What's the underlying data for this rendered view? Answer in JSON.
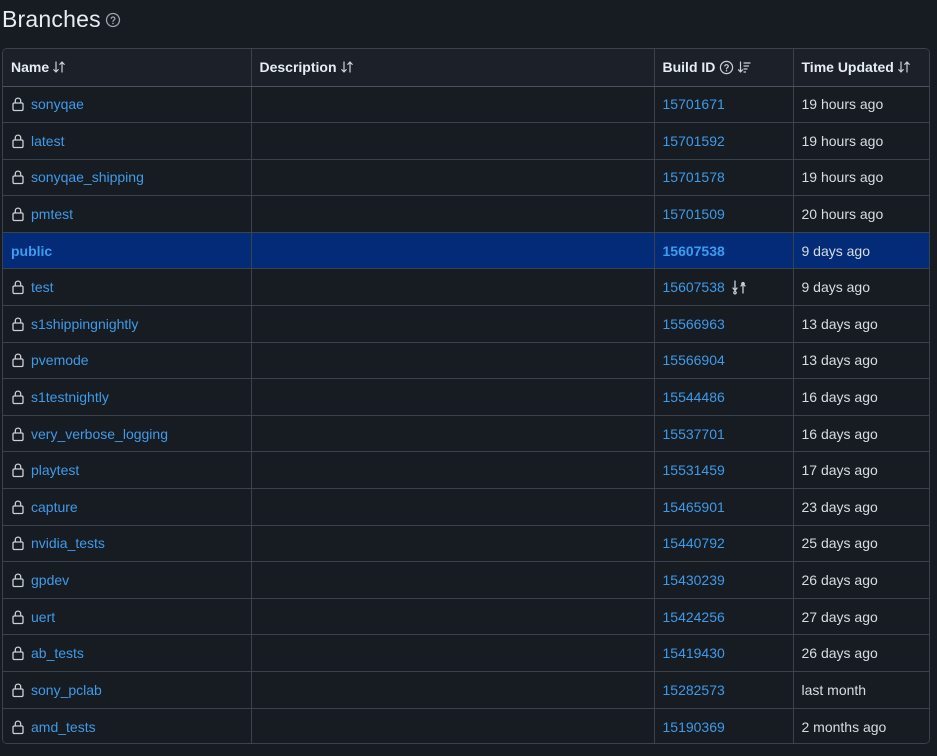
{
  "page": {
    "title": "Branches"
  },
  "table": {
    "columns": {
      "name": "Name",
      "description": "Description",
      "build_id": "Build ID",
      "time_updated": "Time Updated"
    },
    "rows": [
      {
        "name": "sonyqae",
        "description": "",
        "build_id": "15701671",
        "time": "19 hours ago",
        "locked": true
      },
      {
        "name": "latest",
        "description": "",
        "build_id": "15701592",
        "time": "19 hours ago",
        "locked": true
      },
      {
        "name": "sonyqae_shipping",
        "description": "",
        "build_id": "15701578",
        "time": "19 hours ago",
        "locked": true
      },
      {
        "name": "pmtest",
        "description": "",
        "build_id": "15701509",
        "time": "20 hours ago",
        "locked": true
      },
      {
        "name": "public",
        "description": "",
        "build_id": "15607538",
        "time": "9 days ago",
        "locked": false,
        "selected": true
      },
      {
        "name": "test",
        "description": "",
        "build_id": "15607538",
        "time": "9 days ago",
        "locked": true,
        "sync_icon": true
      },
      {
        "name": "s1shippingnightly",
        "description": "",
        "build_id": "15566963",
        "time": "13 days ago",
        "locked": true
      },
      {
        "name": "pvemode",
        "description": "",
        "build_id": "15566904",
        "time": "13 days ago",
        "locked": true
      },
      {
        "name": "s1testnightly",
        "description": "",
        "build_id": "15544486",
        "time": "16 days ago",
        "locked": true
      },
      {
        "name": "very_verbose_logging",
        "description": "",
        "build_id": "15537701",
        "time": "16 days ago",
        "locked": true
      },
      {
        "name": "playtest",
        "description": "",
        "build_id": "15531459",
        "time": "17 days ago",
        "locked": true
      },
      {
        "name": "capture",
        "description": "",
        "build_id": "15465901",
        "time": "23 days ago",
        "locked": true
      },
      {
        "name": "nvidia_tests",
        "description": "",
        "build_id": "15440792",
        "time": "25 days ago",
        "locked": true
      },
      {
        "name": "gpdev",
        "description": "",
        "build_id": "15430239",
        "time": "26 days ago",
        "locked": true
      },
      {
        "name": "uert",
        "description": "",
        "build_id": "15424256",
        "time": "27 days ago",
        "locked": true
      },
      {
        "name": "ab_tests",
        "description": "",
        "build_id": "15419430",
        "time": "26 days ago",
        "locked": true
      },
      {
        "name": "sony_pclab",
        "description": "",
        "build_id": "15282573",
        "time": "last month",
        "locked": true
      },
      {
        "name": "amd_tests",
        "description": "",
        "build_id": "15190369",
        "time": "2 months ago",
        "locked": true
      }
    ]
  },
  "icons": {
    "help": "question-circle-icon",
    "sort": "sort-arrows-icon",
    "sort_desc": "sort-descending-icon",
    "lock": "lock-icon",
    "sync": "sync-icon"
  },
  "colors": {
    "background": "#171b22",
    "link": "#3e9be9",
    "selected_row": "#032b78",
    "border": "#3a424d"
  }
}
